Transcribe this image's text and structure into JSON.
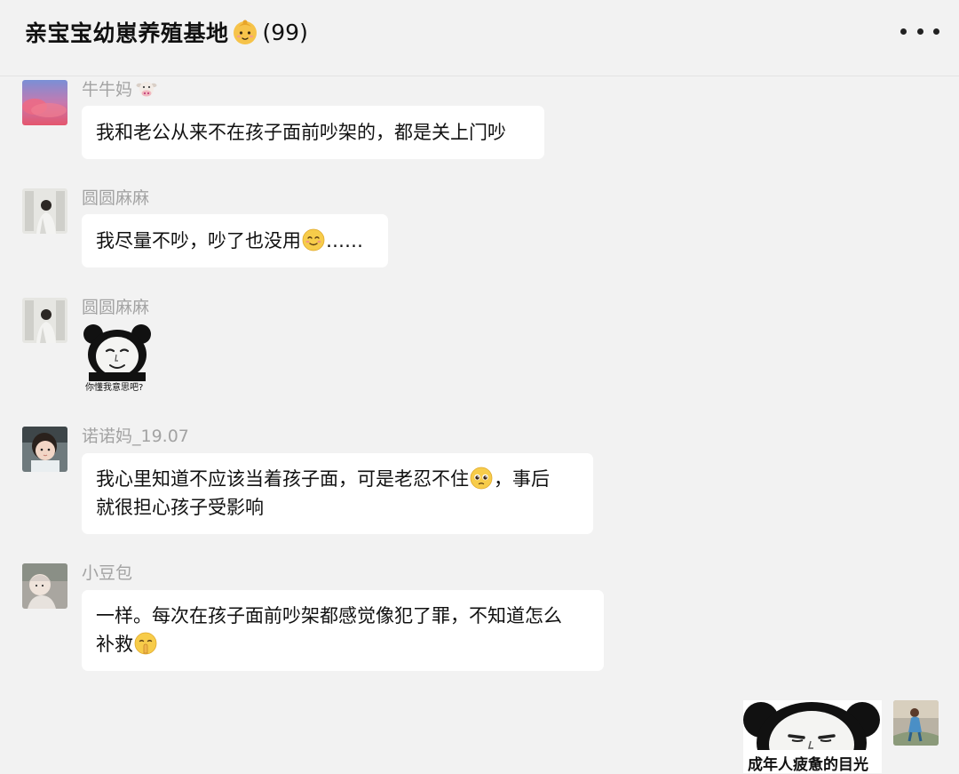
{
  "header": {
    "title": "亲宝宝幼崽养殖基地",
    "title_emoji": "baby-face-icon",
    "member_count": "(99)",
    "more_icon": "more-dots-icon"
  },
  "messages": [
    {
      "sender": "牛牛妈",
      "sender_emoji": "cow-face-icon",
      "text": "我和老公从来不在孩子面前吵架的，都是关上门吵"
    },
    {
      "sender": "圆圆麻麻",
      "text_before": "我尽量不吵，吵了也没用",
      "emoji": "smiling-face-icon",
      "text_after": "……"
    },
    {
      "sender": "圆圆麻麻",
      "sticker": "panda-meme-sticker",
      "sticker_caption": "你懂我意思吧?"
    },
    {
      "sender": "诺诺妈_19.07",
      "line1_before": "我心里知道不应该当着孩子面，可是老忍不住",
      "emoji": "pleading-face-icon",
      "line1_after": "，事后",
      "line2": "就很担心孩子受影响"
    },
    {
      "sender": "小豆包",
      "line1": "一样。每次在孩子面前吵架都感觉像犯了罪，不知道怎么",
      "line2_before": "补救",
      "emoji": "shushing-face-icon"
    }
  ],
  "my_message": {
    "sticker": "panda-meme-sticker",
    "sticker_caption": "成年人疲惫的目光"
  },
  "colors": {
    "background": "#f2f2f2",
    "bubble": "#ffffff",
    "sender_name": "#a3a3a3"
  }
}
